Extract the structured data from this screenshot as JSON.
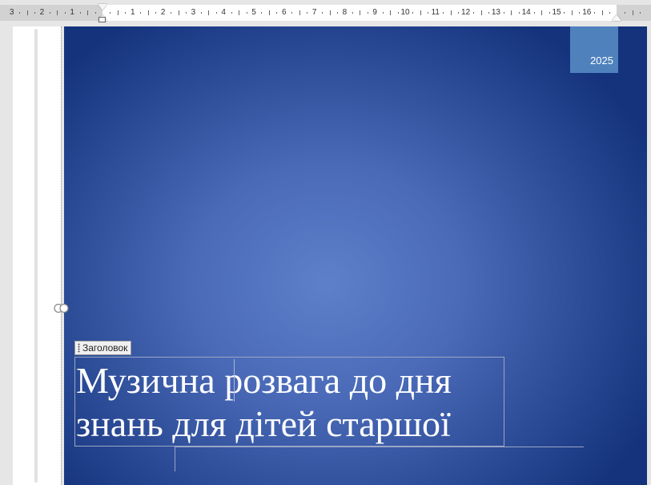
{
  "ruler": {
    "labels_left": [
      "3",
      "2",
      "1"
    ],
    "labels_right": [
      "1",
      "2",
      "3",
      "4",
      "5",
      "6",
      "7",
      "8",
      "9",
      "10",
      "11",
      "12",
      "13",
      "14",
      "15",
      "16"
    ]
  },
  "cover": {
    "year": "2025",
    "title_tag": "Заголовок",
    "title": "Музична розвага до дня\nзнань для дітей старшої"
  },
  "colors": {
    "year_box": "#4f81bd",
    "cover_dark": "#15337d",
    "cover_light": "#5e7fc9"
  },
  "icons": [
    "anchor-icon",
    "drag-handle-icon",
    "indent-marker-icon"
  ]
}
